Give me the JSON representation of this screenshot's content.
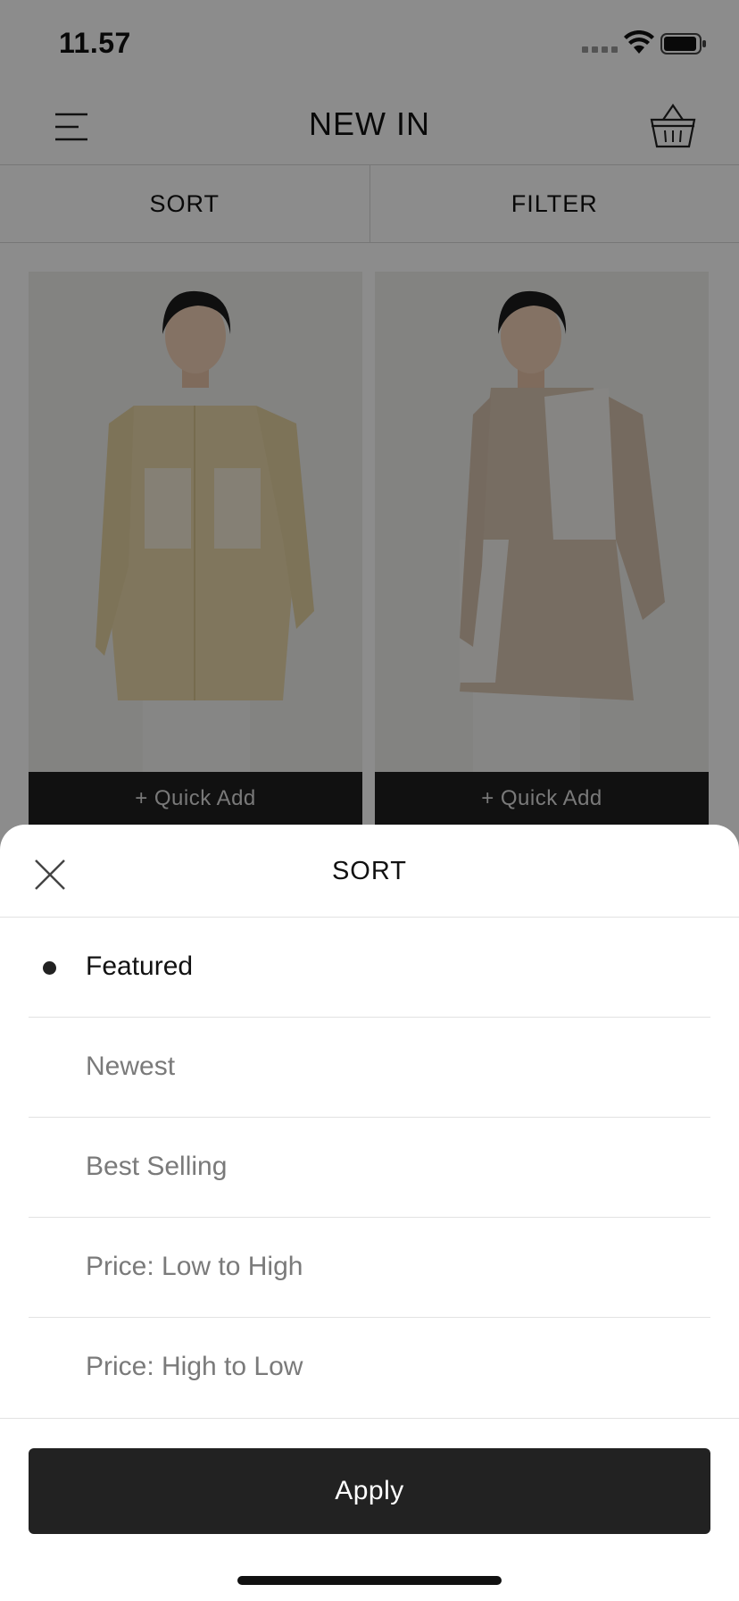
{
  "status_bar": {
    "time": "11.57"
  },
  "header": {
    "title": "NEW IN",
    "menu_icon": "hamburger-menu-icon",
    "cart_icon": "basket-icon"
  },
  "toolbar": {
    "sort_label": "SORT",
    "filter_label": "FILTER"
  },
  "products": [
    {
      "quick_add_label": "+ Quick Add"
    },
    {
      "quick_add_label": "+ Quick Add"
    }
  ],
  "sort_sheet": {
    "title": "SORT",
    "close_icon": "close-icon",
    "options": [
      {
        "label": "Featured",
        "selected": true
      },
      {
        "label": "Newest",
        "selected": false
      },
      {
        "label": "Best Selling",
        "selected": false
      },
      {
        "label": "Price: Low to High",
        "selected": false
      },
      {
        "label": "Price: High to Low",
        "selected": false
      }
    ],
    "apply_label": "Apply"
  },
  "colors": {
    "accent": "#222222",
    "overlay": "rgba(0,0,0,0.45)",
    "muted_text": "#7a7a7a"
  }
}
